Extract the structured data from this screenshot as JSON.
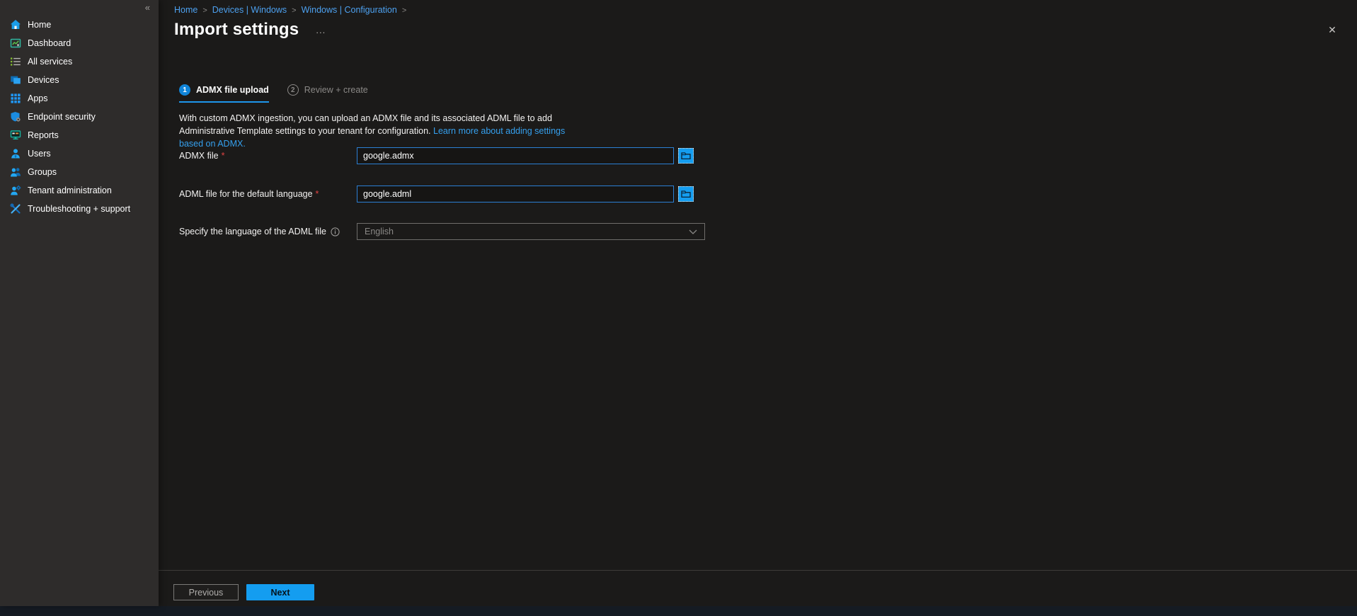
{
  "sidebar": {
    "collapse_glyph": "«",
    "items": [
      {
        "label": "Home",
        "icon": "home-icon"
      },
      {
        "label": "Dashboard",
        "icon": "dashboard-icon"
      },
      {
        "label": "All services",
        "icon": "all-services-icon"
      },
      {
        "label": "Devices",
        "icon": "devices-icon"
      },
      {
        "label": "Apps",
        "icon": "apps-icon"
      },
      {
        "label": "Endpoint security",
        "icon": "endpoint-security-icon"
      },
      {
        "label": "Reports",
        "icon": "reports-icon"
      },
      {
        "label": "Users",
        "icon": "users-icon"
      },
      {
        "label": "Groups",
        "icon": "groups-icon"
      },
      {
        "label": "Tenant administration",
        "icon": "tenant-administration-icon"
      },
      {
        "label": "Troubleshooting + support",
        "icon": "troubleshooting-icon"
      }
    ]
  },
  "breadcrumb": {
    "separator": ">",
    "items": [
      "Home",
      "Devices | Windows",
      "Windows | Configuration"
    ]
  },
  "page": {
    "title": "Import settings",
    "more_glyph": "...",
    "close_glyph": "✕"
  },
  "wizard": {
    "steps": [
      {
        "number": "1",
        "label": "ADMX file upload"
      },
      {
        "number": "2",
        "label": "Review + create"
      }
    ],
    "description": "With custom ADMX ingestion, you can upload an ADMX file and its associated ADML file to add Administrative Template settings to your tenant for configuration.",
    "learn_more_link": "Learn more about adding settings based on ADMX."
  },
  "form": {
    "required_marker": "*",
    "fields": [
      {
        "label": "ADMX file",
        "value": "google.admx"
      },
      {
        "label": "ADML file for the default language",
        "value": "google.adml"
      },
      {
        "label": "Specify the language of the ADML file",
        "value": "English"
      }
    ]
  },
  "footer": {
    "previous_label": "Previous",
    "next_label": "Next"
  },
  "colors": {
    "sidebar_bg": "#2e2c2b",
    "main_bg": "#1b1a19",
    "accent_blue": "#149df0",
    "link_blue": "#4da1f0",
    "step_blue": "#1084d8",
    "input_border_blue": "#2b7fd4",
    "required_red": "#e04343",
    "disabled_gray": "#8a8886"
  }
}
